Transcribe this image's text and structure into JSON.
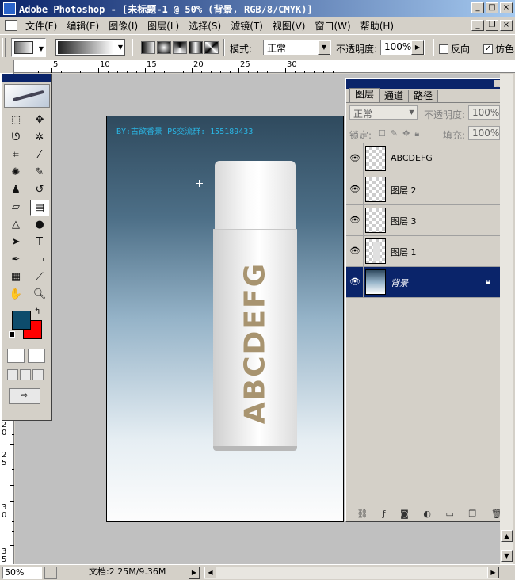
{
  "window": {
    "title": "Adobe Photoshop - [未标题-1 @ 50% (背景, RGB/8/CMYK)]",
    "minimize": "_",
    "maximize": "□",
    "close": "×"
  },
  "menu": [
    "文件(F)",
    "编辑(E)",
    "图像(I)",
    "图层(L)",
    "选择(S)",
    "滤镜(T)",
    "视图(V)",
    "窗口(W)",
    "帮助(H)"
  ],
  "options_bar": {
    "mode_label": "模式:",
    "mode_value": "正常",
    "opacity_label": "不透明度:",
    "opacity_value": "100%",
    "reverse_label": "反向",
    "reverse_checked": false,
    "dither_label": "仿色",
    "dither_checked": true
  },
  "ruler": {
    "h_labels": [
      "5",
      "10",
      "15",
      "20",
      "25",
      "30"
    ],
    "v_labels": [
      "2",
      "0",
      "2",
      "5",
      "3",
      "0",
      "3",
      "5"
    ]
  },
  "canvas": {
    "watermark": "BY:古欲香景 PS交流群: 155189433",
    "bottle_text": "ABCDEFG"
  },
  "tools": {
    "foreground_color": "#0d4c6c",
    "background_color": "#ff0000"
  },
  "layers_panel": {
    "tabs": [
      "图层",
      "通道",
      "路径"
    ],
    "blend_mode": "正常",
    "opacity_label": "不透明度:",
    "opacity_value": "100%",
    "lock_label": "锁定:",
    "fill_label": "填充:",
    "fill_value": "100%",
    "layers": [
      {
        "name": "ABCDEFG",
        "selected": false
      },
      {
        "name": "图层 2",
        "selected": false
      },
      {
        "name": "图层 3",
        "selected": false
      },
      {
        "name": "图层 1",
        "selected": false
      },
      {
        "name": "背景",
        "selected": true
      }
    ]
  },
  "status": {
    "zoom": "50%",
    "doc_info": "文档:2.25M/9.36M"
  }
}
